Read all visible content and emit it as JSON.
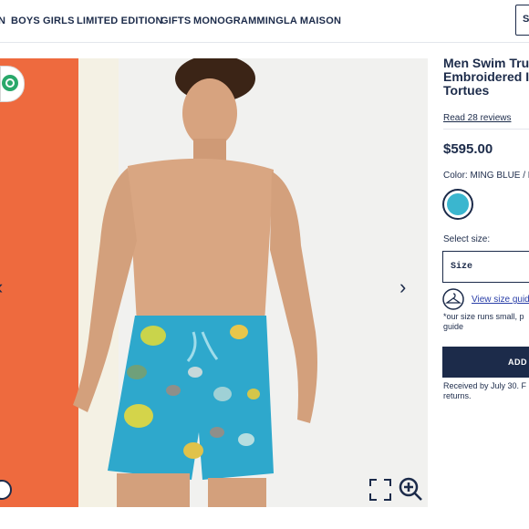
{
  "nav": {
    "items": [
      "N",
      "BOYS",
      "GIRLS",
      "LIMITED EDITION",
      "GIFTS",
      "MONOGRAMMING",
      "LA MAISON"
    ],
    "search_label": "S"
  },
  "product": {
    "title": "Men Swim Tru\nEmbroidered I\nTortues",
    "reviews": "Read 28 reviews",
    "price": "$595.00",
    "color_label": "Color: MING BLUE / B",
    "swatch_color": "#3ab6cf",
    "size_label": "Select size:",
    "size_placeholder": "Size",
    "size_guide_link": "View size guid",
    "size_note": "*our size runs small, p guide",
    "add_button": "ADD T",
    "delivery": "Received by July 30. F returns."
  },
  "gallery": {
    "icons": [
      "chevron-left-icon",
      "chevron-right-icon",
      "fullscreen-icon",
      "zoom-in-icon",
      "brand-logo-badge",
      "chat-icon"
    ]
  }
}
